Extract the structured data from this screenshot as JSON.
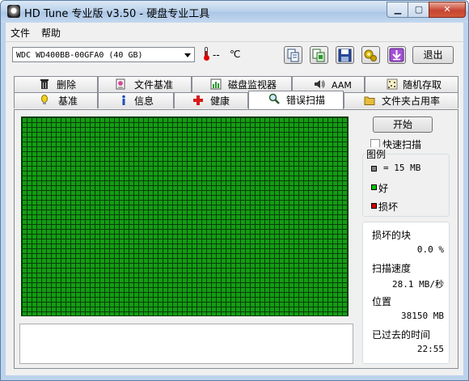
{
  "window": {
    "title": "HD Tune 专业版 v3.50 - 硬盘专业工具",
    "min_glyph": "▁",
    "max_glyph": "▢",
    "close_glyph": "✕"
  },
  "menu": [
    "文件",
    "帮助"
  ],
  "toolbar": {
    "drive": "WDC WD400BB-00GFA0 (40 GB)",
    "temperature": "--",
    "temp_unit": "℃",
    "exit_label": "退出",
    "buttons": [
      "copy-info-icon",
      "copy-screenshot-icon",
      "save-icon",
      "options-icon",
      "download-icon"
    ]
  },
  "tabs_top": [
    "删除",
    "文件基准",
    "磁盘监视器",
    "AAM",
    "随机存取"
  ],
  "tabs_bottom": [
    "基准",
    "信息",
    "健康",
    "错误扫描",
    "文件夹占用率"
  ],
  "active_tab": "错误扫描",
  "scan": {
    "start_label": "开始",
    "quick_scan_label": "快速扫描",
    "quick_scan_checked": false,
    "legend_title": "图例",
    "legend": [
      {
        "label": "= 15 MB",
        "color": "#808080"
      },
      {
        "label": "好",
        "color": "#00c000"
      },
      {
        "label": "损坏",
        "color": "#d00000"
      }
    ],
    "block_color": "#139d13"
  },
  "stats": [
    {
      "label": "损坏的块",
      "value": "0.0 %"
    },
    {
      "label": "扫描速度",
      "value": "28.1 MB/秒"
    },
    {
      "label": "位置",
      "value": "38150 MB"
    },
    {
      "label": "已过去的时间",
      "value": "22:55"
    }
  ]
}
